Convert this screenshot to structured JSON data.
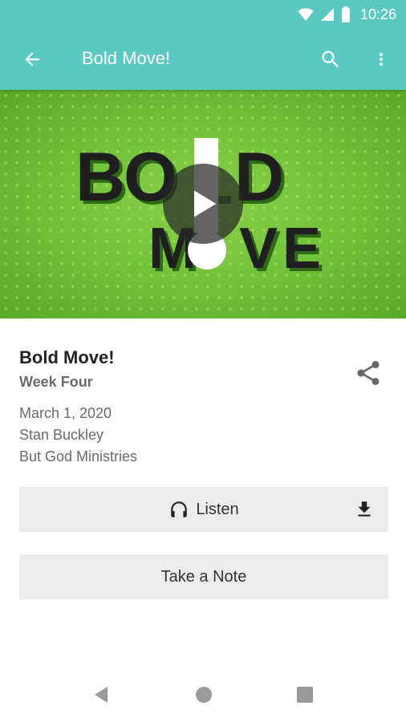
{
  "status_bar": {
    "time": "10:26"
  },
  "app_bar": {
    "title": "Bold Move!"
  },
  "hero": {
    "logo_text": "BOLD MOVE!"
  },
  "sermon": {
    "title": "Bold Move!",
    "subtitle": "Week Four",
    "date": "March 1, 2020",
    "speaker": "Stan Buckley",
    "ministry": "But God Ministries"
  },
  "actions": {
    "listen_label": "Listen",
    "note_label": "Take a Note"
  },
  "colors": {
    "app_bar": "#5cc8c2",
    "hero_green": "#6fbf38",
    "button_bg": "#ececec"
  }
}
